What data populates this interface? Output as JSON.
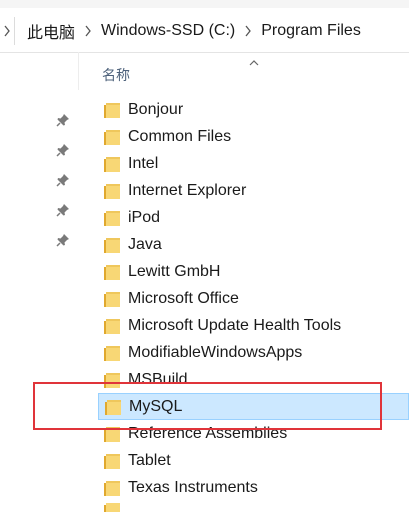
{
  "breadcrumb": {
    "items": [
      "此电脑",
      "Windows-SSD (C:)",
      "Program Files"
    ]
  },
  "list_header": {
    "name_column": "名称"
  },
  "folders": [
    {
      "name": "Bonjour"
    },
    {
      "name": "Common Files"
    },
    {
      "name": "Intel"
    },
    {
      "name": "Internet Explorer"
    },
    {
      "name": "iPod"
    },
    {
      "name": "Java"
    },
    {
      "name": "Lewitt GmbH"
    },
    {
      "name": "Microsoft Office"
    },
    {
      "name": "Microsoft Update Health Tools"
    },
    {
      "name": "ModifiableWindowsApps"
    },
    {
      "name": "MSBuild"
    },
    {
      "name": "MySQL"
    },
    {
      "name": "Reference Assemblies"
    },
    {
      "name": "Tablet"
    },
    {
      "name": "Texas Instruments"
    }
  ],
  "selected_folder": "MySQL",
  "colors": {
    "selection_bg": "#cce8ff",
    "selection_border": "#99d1ff",
    "highlight_box": "#e0343a",
    "folder_yellow": "#f8d775",
    "folder_dark": "#e0a82e"
  }
}
